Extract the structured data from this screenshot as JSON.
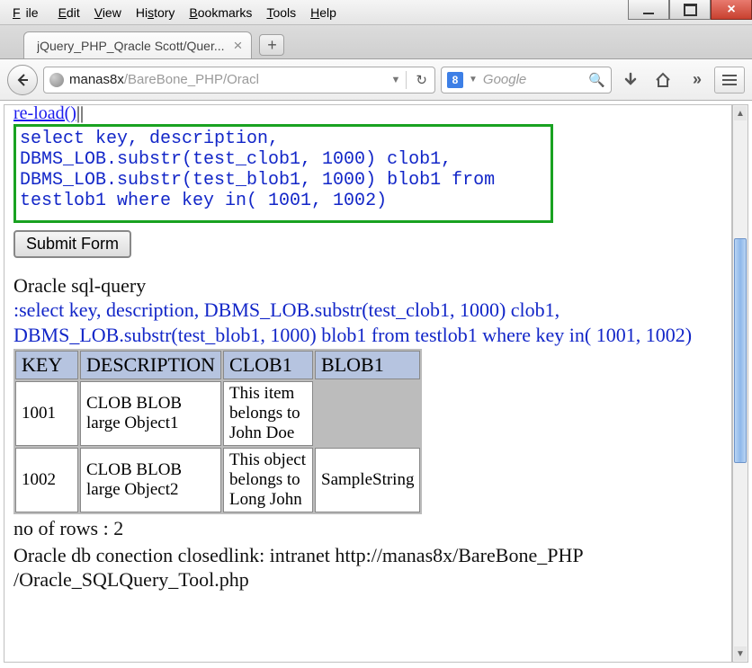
{
  "menubar": {
    "file": "File",
    "edit": "Edit",
    "view": "View",
    "history": "History",
    "bookmarks": "Bookmarks",
    "tools": "Tools",
    "help": "Help"
  },
  "tab": {
    "title": "jQuery_PHP_Qracle Scott/Quer..."
  },
  "url": {
    "host": "manas8x",
    "path": "/BareBone_PHP/Oracl"
  },
  "search": {
    "badge": "8",
    "placeholder": "Google"
  },
  "page": {
    "reload_link": "re-load()",
    "reload_sep": "||",
    "sql": "select key, description,\nDBMS_LOB.substr(test_clob1, 1000) clob1,\nDBMS_LOB.substr(test_blob1, 1000) blob1 from testlob1 where key in( 1001, 1002)",
    "submit": "Submit Form",
    "section_title": "Oracle sql-query",
    "echo_query": ":select key, description, DBMS_LOB.substr(test_clob1, 1000) clob1, DBMS_LOB.substr(test_blob1, 1000) blob1 from testlob1 where key in( 1001, 1002)",
    "table": {
      "headers": [
        "KEY",
        "DESCRIPTION",
        "CLOB1",
        "BLOB1"
      ],
      "rows": [
        {
          "key": "1001",
          "description": "CLOB BLOB large Object1",
          "clob1": "This item belongs to John Doe",
          "blob1": ""
        },
        {
          "key": "1002",
          "description": "CLOB BLOB large Object2",
          "clob1": "This object belongs to Long John",
          "blob1": "SampleString"
        }
      ]
    },
    "row_count": "no of rows : 2",
    "footer": "Oracle db conection closedlink: intranet http://manas8x/BareBone_PHP /Oracle_SQLQuery_Tool.php"
  }
}
